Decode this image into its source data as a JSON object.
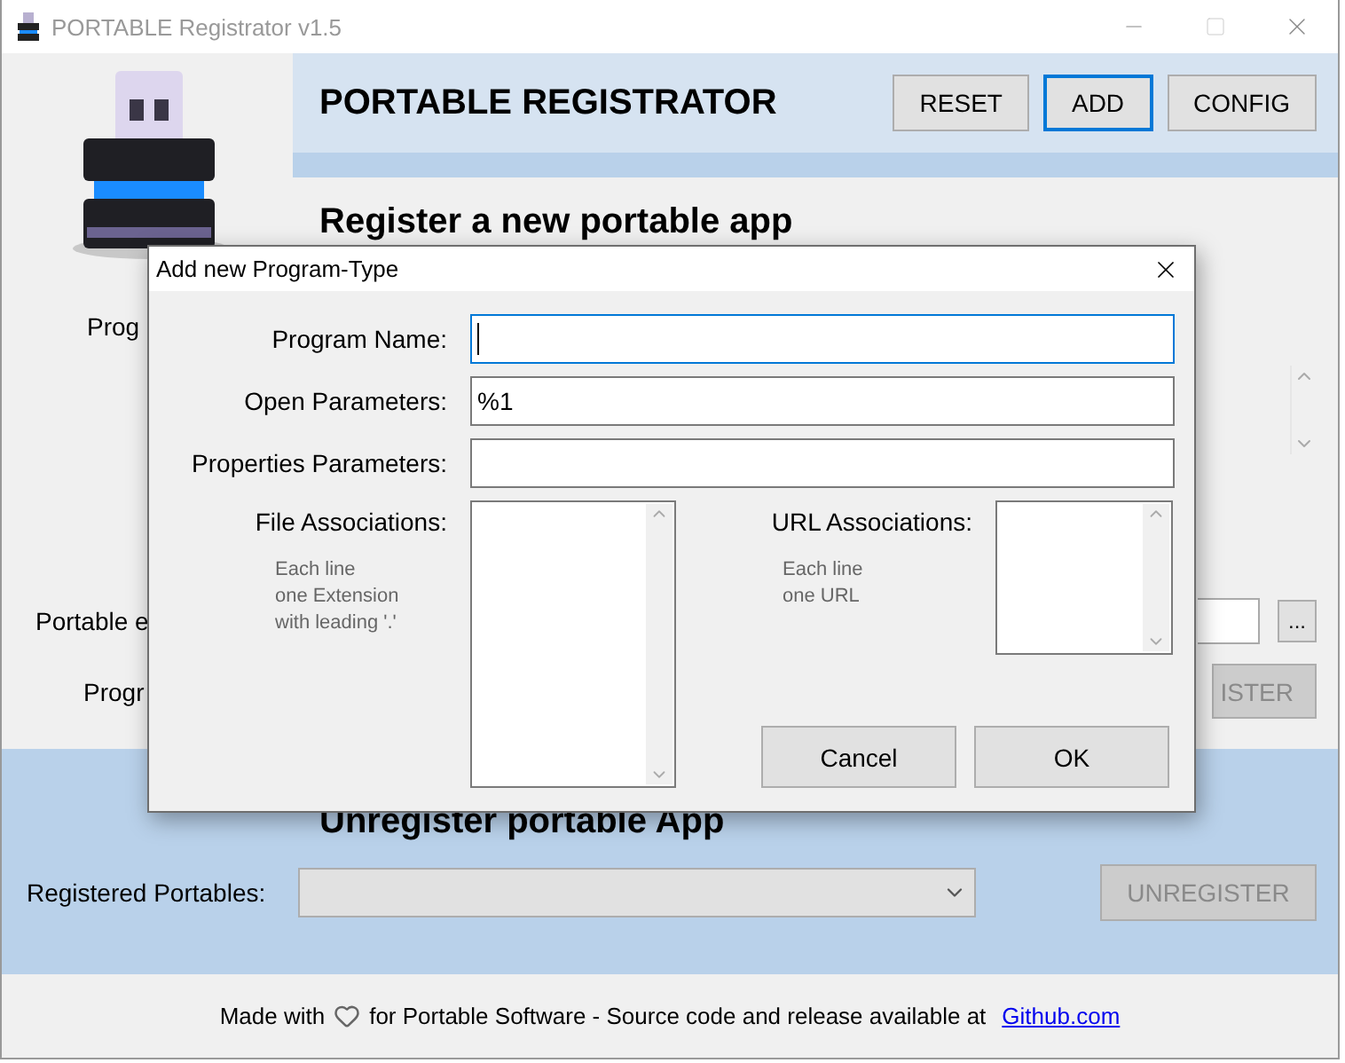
{
  "window": {
    "title": "PORTABLE Registrator v1.5"
  },
  "header": {
    "title": "PORTABLE REGISTRATOR",
    "buttons": [
      {
        "label": "RESET",
        "focused": false
      },
      {
        "label": "ADD",
        "focused": true
      },
      {
        "label": "CONFIG",
        "focused": false
      }
    ]
  },
  "register_section": {
    "heading": "Register a new portable app",
    "labels": [
      "Prog",
      "Portable e",
      "Progr"
    ],
    "browse_button": "...",
    "register_button": {
      "label": "ISTER",
      "disabled": true
    }
  },
  "unregister_section": {
    "heading": "Unregister portable App",
    "label": "Registered Portables:",
    "unregister_button": {
      "label": "UNREGISTER",
      "disabled": true
    }
  },
  "footer": {
    "text_before": "Made with",
    "text_after": "for Portable Software - Source code and release available at",
    "link": "Github.com"
  },
  "dialog": {
    "title": "Add new Program-Type",
    "fields": [
      {
        "label": "Program Name:",
        "focused": true
      },
      {
        "label": "Open Parameters:",
        "value": "%1",
        "focused": false
      },
      {
        "label": "Properties Parameters:",
        "focused": false
      }
    ],
    "associations": [
      {
        "label": "File Associations:",
        "hint": "Each line\none Extension\nwith leading '.'"
      },
      {
        "label": "URL Associations:",
        "hint": "Each line\none URL"
      }
    ],
    "buttons": [
      "Cancel",
      "OK"
    ]
  }
}
